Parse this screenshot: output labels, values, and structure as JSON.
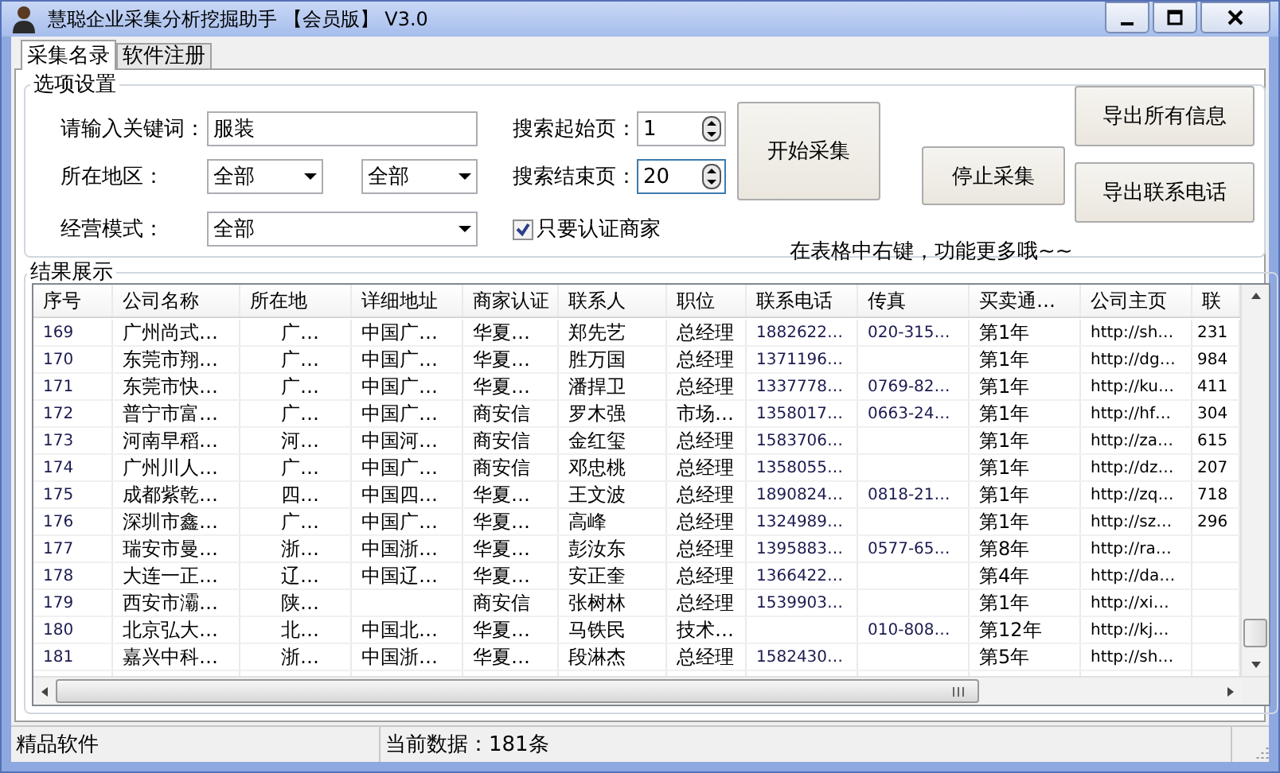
{
  "window": {
    "title": "慧聪企业采集分析挖掘助手 【会员版】 V3.0"
  },
  "tabs": [
    {
      "label": "采集名录",
      "selected": true
    },
    {
      "label": "软件注册",
      "selected": false
    }
  ],
  "options": {
    "title": "选项设置",
    "keyword": {
      "label": "请输入关键词：",
      "value": "服装"
    },
    "region": {
      "label": "所在地区：",
      "province": "全部",
      "city": "全部"
    },
    "mode": {
      "label": "经营模式：",
      "value": "全部"
    },
    "start_page": {
      "label": "搜索起始页：",
      "value": "1"
    },
    "end_page": {
      "label": "搜索结束页：",
      "value": "20"
    },
    "verified_only": {
      "label": "只要认证商家",
      "checked": true
    },
    "start_button": "开始采集",
    "stop_button": "停止采集",
    "export_all_button": "导出所有信息",
    "export_phone_button": "导出联系电话",
    "hint": "在表格中右键，功能更多哦~~"
  },
  "results": {
    "title": "结果展示",
    "columns": [
      "序号",
      "公司名称",
      "所在地",
      "详细地址",
      "商家认证",
      "联系人",
      "职位",
      "联系电话",
      "传真",
      "买卖通…",
      "公司主页",
      "联"
    ],
    "rows": [
      [
        "169",
        "广州尚式…",
        "广…",
        "中国广…",
        "华夏…",
        "郑先艺",
        "总经理",
        "1882622…",
        "020-315…",
        "第1年",
        "http://sh…",
        "231"
      ],
      [
        "170",
        "东莞市翔…",
        "广…",
        "中国广…",
        "华夏…",
        "胜万国",
        "总经理",
        "1371196…",
        "",
        "第1年",
        "http://dg…",
        "984"
      ],
      [
        "171",
        "东莞市快…",
        "广…",
        "中国广…",
        "华夏…",
        "潘捍卫",
        "总经理",
        "1337778…",
        "0769-82…",
        "第1年",
        "http://ku…",
        "411"
      ],
      [
        "172",
        "普宁市富…",
        "广…",
        "中国广…",
        "商安信",
        "罗木强",
        "市场…",
        "1358017…",
        "0663-24…",
        "第1年",
        "http://hf…",
        "304"
      ],
      [
        "173",
        "河南早稻…",
        "河…",
        "中国河…",
        "商安信",
        "金红玺",
        "总经理",
        "1583706…",
        "",
        "第1年",
        "http://za…",
        "615"
      ],
      [
        "174",
        "广州川人…",
        "广…",
        "中国广…",
        "商安信",
        "邓忠桃",
        "总经理",
        "1358055…",
        "",
        "第1年",
        "http://dz…",
        "207"
      ],
      [
        "175",
        "成都紫乾…",
        "四…",
        "中国四…",
        "华夏…",
        "王文波",
        "总经理",
        "1890824…",
        "0818-21…",
        "第1年",
        "http://zq…",
        "718"
      ],
      [
        "176",
        "深圳市鑫…",
        "广…",
        "中国广…",
        "华夏…",
        "高峰",
        "总经理",
        "1324989…",
        "",
        "第1年",
        "http://sz…",
        "296"
      ],
      [
        "177",
        "瑞安市曼…",
        "浙…",
        "中国浙…",
        "华夏…",
        "彭汝东",
        "总经理",
        "1395883…",
        "0577-65…",
        "第8年",
        "http://ra…",
        ""
      ],
      [
        "178",
        "大连一正…",
        "辽…",
        "中国辽…",
        "华夏…",
        "安正奎",
        "总经理",
        "1366422…",
        "",
        "第4年",
        "http://da…",
        ""
      ],
      [
        "179",
        "西安市灞…",
        "陕…",
        "",
        "商安信",
        "张树林",
        "总经理",
        "1539903…",
        "",
        "第1年",
        "http://xi…",
        ""
      ],
      [
        "180",
        "北京弘大…",
        "北…",
        "中国北…",
        "华夏…",
        "马铁民",
        "技术…",
        "",
        "010-808…",
        "第12年",
        "http://kj…",
        ""
      ],
      [
        "181",
        "嘉兴中科…",
        "浙…",
        "中国浙…",
        "华夏…",
        "段淋杰",
        "总经理",
        "1582430…",
        "",
        "第5年",
        "http://sh…",
        ""
      ]
    ]
  },
  "status_bar": [
    "精品软件",
    "当前数据：181条"
  ]
}
